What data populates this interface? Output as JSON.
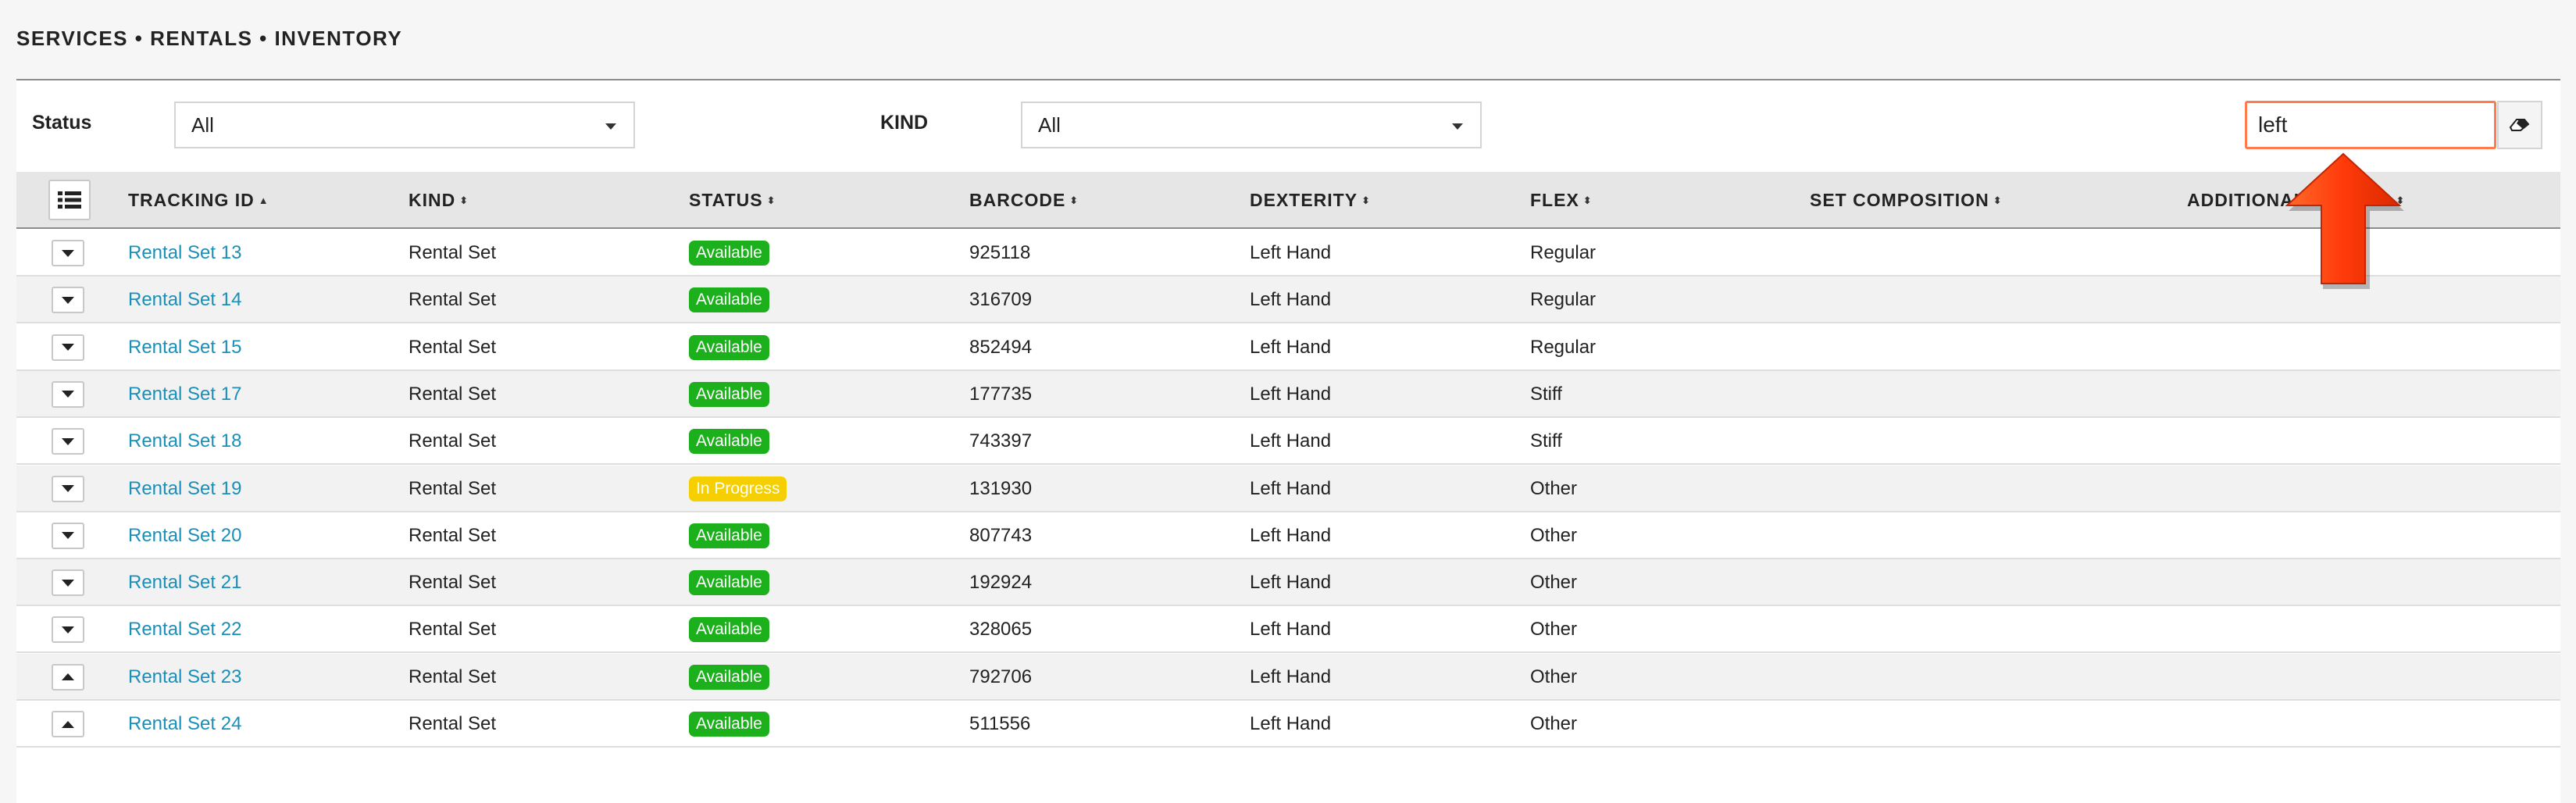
{
  "breadcrumb": "SERVICES • RENTALS • INVENTORY",
  "filters": {
    "status_label": "Status",
    "status_value": "All",
    "kind_label": "KIND",
    "kind_value": "All"
  },
  "search": {
    "value": "left"
  },
  "icons": {
    "clear": "eraser-icon",
    "column_menu": "list-icon",
    "row_toggle_collapsed": "chevron-down-icon",
    "row_toggle_expanded": "chevron-up-icon"
  },
  "colors": {
    "link": "#1a8fb8",
    "available": "#1db01d",
    "in_progress": "#f5cf00",
    "search_border": "#ff7a4d",
    "arrow": "#ff3a0a"
  },
  "table": {
    "headers": {
      "tracking_id": "TRACKING ID",
      "kind": "KIND",
      "status": "STATUS",
      "barcode": "BARCODE",
      "dexterity": "DEXTERITY",
      "flex": "FLEX",
      "set_composition": "SET COMPOSITION",
      "additional_details": "ADDITIONAL DETAILS"
    },
    "rows": [
      {
        "toggle": "down",
        "tracking_id": "Rental Set 13",
        "kind": "Rental Set",
        "status": "Available",
        "barcode": "925118",
        "dexterity": "Left Hand",
        "flex": "Regular",
        "set_composition": "",
        "additional_details": ""
      },
      {
        "toggle": "down",
        "tracking_id": "Rental Set 14",
        "kind": "Rental Set",
        "status": "Available",
        "barcode": "316709",
        "dexterity": "Left Hand",
        "flex": "Regular",
        "set_composition": "",
        "additional_details": ""
      },
      {
        "toggle": "down",
        "tracking_id": "Rental Set 15",
        "kind": "Rental Set",
        "status": "Available",
        "barcode": "852494",
        "dexterity": "Left Hand",
        "flex": "Regular",
        "set_composition": "",
        "additional_details": ""
      },
      {
        "toggle": "down",
        "tracking_id": "Rental Set 17",
        "kind": "Rental Set",
        "status": "Available",
        "barcode": "177735",
        "dexterity": "Left Hand",
        "flex": "Stiff",
        "set_composition": "",
        "additional_details": ""
      },
      {
        "toggle": "down",
        "tracking_id": "Rental Set 18",
        "kind": "Rental Set",
        "status": "Available",
        "barcode": "743397",
        "dexterity": "Left Hand",
        "flex": "Stiff",
        "set_composition": "",
        "additional_details": ""
      },
      {
        "toggle": "down",
        "tracking_id": "Rental Set 19",
        "kind": "Rental Set",
        "status": "In Progress",
        "barcode": "131930",
        "dexterity": "Left Hand",
        "flex": "Other",
        "set_composition": "",
        "additional_details": ""
      },
      {
        "toggle": "down",
        "tracking_id": "Rental Set 20",
        "kind": "Rental Set",
        "status": "Available",
        "barcode": "807743",
        "dexterity": "Left Hand",
        "flex": "Other",
        "set_composition": "",
        "additional_details": ""
      },
      {
        "toggle": "down",
        "tracking_id": "Rental Set 21",
        "kind": "Rental Set",
        "status": "Available",
        "barcode": "192924",
        "dexterity": "Left Hand",
        "flex": "Other",
        "set_composition": "",
        "additional_details": ""
      },
      {
        "toggle": "down",
        "tracking_id": "Rental Set 22",
        "kind": "Rental Set",
        "status": "Available",
        "barcode": "328065",
        "dexterity": "Left Hand",
        "flex": "Other",
        "set_composition": "",
        "additional_details": ""
      },
      {
        "toggle": "up",
        "tracking_id": "Rental Set 23",
        "kind": "Rental Set",
        "status": "Available",
        "barcode": "792706",
        "dexterity": "Left Hand",
        "flex": "Other",
        "set_composition": "",
        "additional_details": ""
      },
      {
        "toggle": "up",
        "tracking_id": "Rental Set 24",
        "kind": "Rental Set",
        "status": "Available",
        "barcode": "511556",
        "dexterity": "Left Hand",
        "flex": "Other",
        "set_composition": "",
        "additional_details": ""
      }
    ]
  }
}
